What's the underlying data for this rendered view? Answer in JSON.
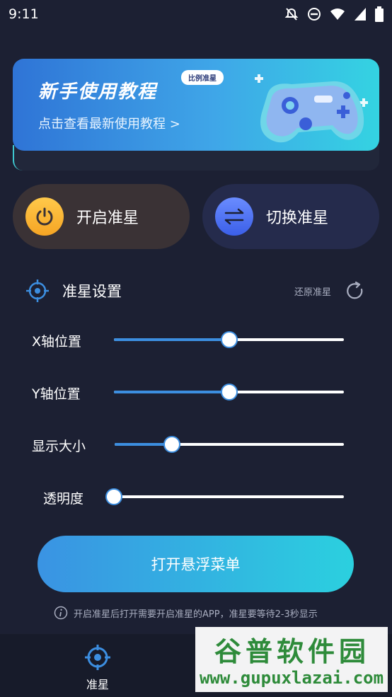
{
  "status_bar": {
    "time": "9:11",
    "icons": [
      "bell-off-icon",
      "dnd-icon",
      "wifi-icon",
      "signal-icon",
      "battery-icon"
    ]
  },
  "banner": {
    "title": "新手使用教程",
    "badge": "比例准星",
    "subtitle": "点击查看最新使用教程 >"
  },
  "actions": {
    "enable_label": "开启准星",
    "switch_label": "切换准星"
  },
  "settings": {
    "title": "准星设置",
    "reset_label": "还原准星",
    "sliders": [
      {
        "label": "X轴位置",
        "value": 0.5
      },
      {
        "label": "Y轴位置",
        "value": 0.5
      },
      {
        "label": "显示大小",
        "value": 0.25
      },
      {
        "label": "透明度",
        "value": 0.0
      }
    ]
  },
  "cta": {
    "label": "打开悬浮菜单"
  },
  "hint": {
    "text": "开启准星后打开需要开启准星的APP，准星要等待2-3秒显示"
  },
  "bottom_nav": {
    "items": [
      {
        "label": "准星",
        "icon": "crosshair-icon"
      }
    ]
  },
  "watermark": {
    "main": "谷普软件园",
    "url": "www.gupuxlazai.com"
  },
  "colors": {
    "background": "#1c2033",
    "accent_blue": "#3c8ee0",
    "accent_cyan": "#2bd0df",
    "power_yellow": "#f6a524"
  }
}
